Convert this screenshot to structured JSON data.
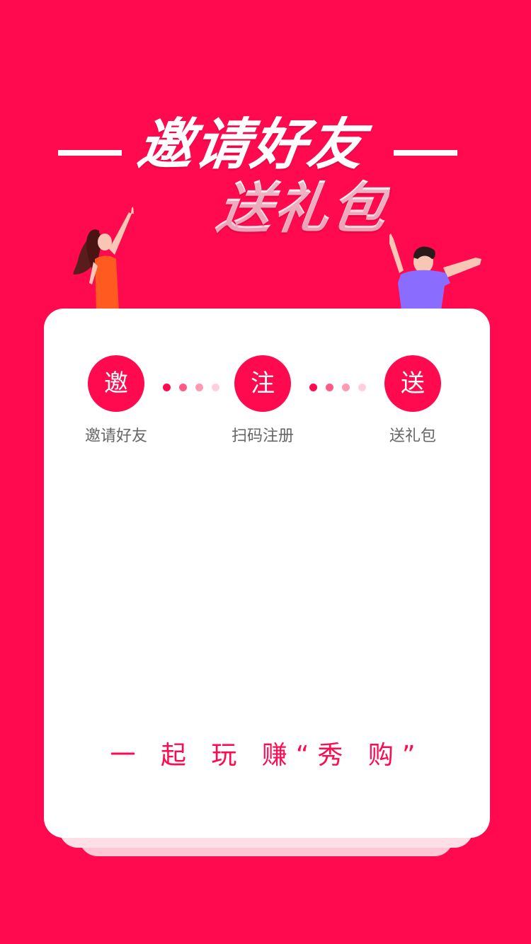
{
  "header": {
    "title_line1": "邀请好友",
    "title_line2": "送礼包"
  },
  "steps": [
    {
      "icon_char": "邀",
      "label": "邀请好友"
    },
    {
      "icon_char": "注",
      "label": "扫码注册"
    },
    {
      "icon_char": "送",
      "label": "送礼包"
    }
  ],
  "slogan": "一 起 玩 赚“秀 购”",
  "colors": {
    "background": "#ff0a4e",
    "card": "#ffffff",
    "label_text": "#666666"
  },
  "illustrations": [
    "woman-pointing-illustration",
    "man-waving-illustration"
  ]
}
